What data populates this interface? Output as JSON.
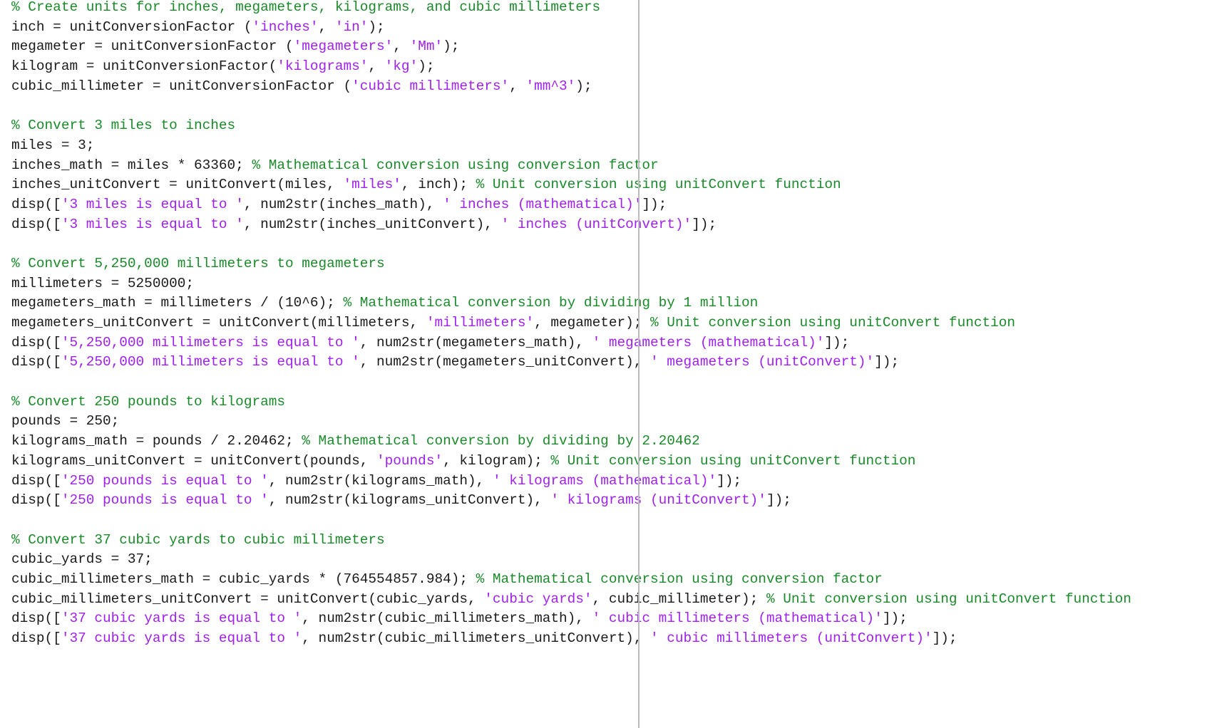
{
  "editor": {
    "language": "matlab",
    "colors": {
      "plain": "#1a1a1a",
      "comment": "#1a8a2a",
      "string": "#a020f0",
      "right_margin_line": "#bdbdbd"
    },
    "lines": [
      [
        [
          "comment",
          "% Create units for inches, megameters, kilograms, and cubic millimeters"
        ]
      ],
      [
        [
          "plain",
          "inch = unitConversionFactor ("
        ],
        [
          "string",
          "'inches'"
        ],
        [
          "plain",
          ", "
        ],
        [
          "string",
          "'in'"
        ],
        [
          "plain",
          ");"
        ]
      ],
      [
        [
          "plain",
          "megameter = unitConversionFactor ("
        ],
        [
          "string",
          "'megameters'"
        ],
        [
          "plain",
          ", "
        ],
        [
          "string",
          "'Mm'"
        ],
        [
          "plain",
          ");"
        ]
      ],
      [
        [
          "plain",
          "kilogram = unitConversionFactor("
        ],
        [
          "string",
          "'kilograms'"
        ],
        [
          "plain",
          ", "
        ],
        [
          "string",
          "'kg'"
        ],
        [
          "plain",
          ");"
        ]
      ],
      [
        [
          "plain",
          "cubic_millimeter = unitConversionFactor ("
        ],
        [
          "string",
          "'cubic millimeters'"
        ],
        [
          "plain",
          ", "
        ],
        [
          "string",
          "'mm^3'"
        ],
        [
          "plain",
          ");"
        ]
      ],
      [],
      [
        [
          "comment",
          "% Convert 3 miles to inches"
        ]
      ],
      [
        [
          "plain",
          "miles = 3;"
        ]
      ],
      [
        [
          "plain",
          "inches_math = miles * 63360; "
        ],
        [
          "comment",
          "% Mathematical conversion using conversion factor"
        ]
      ],
      [
        [
          "plain",
          "inches_unitConvert = unitConvert(miles, "
        ],
        [
          "string",
          "'miles'"
        ],
        [
          "plain",
          ", inch); "
        ],
        [
          "comment",
          "% Unit conversion using unitConvert function"
        ]
      ],
      [
        [
          "plain",
          "disp(["
        ],
        [
          "string",
          "'3 miles is equal to '"
        ],
        [
          "plain",
          ", num2str(inches_math), "
        ],
        [
          "string",
          "' inches (mathematical)'"
        ],
        [
          "plain",
          "]);"
        ]
      ],
      [
        [
          "plain",
          "disp(["
        ],
        [
          "string",
          "'3 miles is equal to '"
        ],
        [
          "plain",
          ", num2str(inches_unitConvert), "
        ],
        [
          "string",
          "' inches (unitConvert)'"
        ],
        [
          "plain",
          "]);"
        ]
      ],
      [],
      [
        [
          "comment",
          "% Convert 5,250,000 millimeters to megameters"
        ]
      ],
      [
        [
          "plain",
          "millimeters = 5250000;"
        ]
      ],
      [
        [
          "plain",
          "megameters_math = millimeters / (10^6); "
        ],
        [
          "comment",
          "% Mathematical conversion by dividing by 1 million"
        ]
      ],
      [
        [
          "plain",
          "megameters_unitConvert = unitConvert(millimeters, "
        ],
        [
          "string",
          "'millimeters'"
        ],
        [
          "plain",
          ", megameter); "
        ],
        [
          "comment",
          "% Unit conversion using unitConvert function"
        ]
      ],
      [
        [
          "plain",
          "disp(["
        ],
        [
          "string",
          "'5,250,000 millimeters is equal to '"
        ],
        [
          "plain",
          ", num2str(megameters_math), "
        ],
        [
          "string",
          "' megameters (mathematical)'"
        ],
        [
          "plain",
          "]);"
        ]
      ],
      [
        [
          "plain",
          "disp(["
        ],
        [
          "string",
          "'5,250,000 millimeters is equal to '"
        ],
        [
          "plain",
          ", num2str(megameters_unitConvert), "
        ],
        [
          "string",
          "' megameters (unitConvert)'"
        ],
        [
          "plain",
          "]);"
        ]
      ],
      [],
      [
        [
          "comment",
          "% Convert 250 pounds to kilograms"
        ]
      ],
      [
        [
          "plain",
          "pounds = 250;"
        ]
      ],
      [
        [
          "plain",
          "kilograms_math = pounds / 2.20462; "
        ],
        [
          "comment",
          "% Mathematical conversion by dividing by 2.20462"
        ]
      ],
      [
        [
          "plain",
          "kilograms_unitConvert = unitConvert(pounds, "
        ],
        [
          "string",
          "'pounds'"
        ],
        [
          "plain",
          ", kilogram); "
        ],
        [
          "comment",
          "% Unit conversion using unitConvert function"
        ]
      ],
      [
        [
          "plain",
          "disp(["
        ],
        [
          "string",
          "'250 pounds is equal to '"
        ],
        [
          "plain",
          ", num2str(kilograms_math), "
        ],
        [
          "string",
          "' kilograms (mathematical)'"
        ],
        [
          "plain",
          "]);"
        ]
      ],
      [
        [
          "plain",
          "disp(["
        ],
        [
          "string",
          "'250 pounds is equal to '"
        ],
        [
          "plain",
          ", num2str(kilograms_unitConvert), "
        ],
        [
          "string",
          "' kilograms (unitConvert)'"
        ],
        [
          "plain",
          "]);"
        ]
      ],
      [],
      [
        [
          "comment",
          "% Convert 37 cubic yards to cubic millimeters"
        ]
      ],
      [
        [
          "plain",
          "cubic_yards = 37;"
        ]
      ],
      [
        [
          "plain",
          "cubic_millimeters_math = cubic_yards * (764554857.984); "
        ],
        [
          "comment",
          "% Mathematical conversion using conversion factor"
        ]
      ],
      [
        [
          "plain",
          "cubic_millimeters_unitConvert = unitConvert(cubic_yards, "
        ],
        [
          "string",
          "'cubic yards'"
        ],
        [
          "plain",
          ", cubic_millimeter); "
        ],
        [
          "comment",
          "% Unit conversion using unitConvert function"
        ]
      ],
      [
        [
          "plain",
          "disp(["
        ],
        [
          "string",
          "'37 cubic yards is equal to '"
        ],
        [
          "plain",
          ", num2str(cubic_millimeters_math), "
        ],
        [
          "string",
          "' cubic millimeters (mathematical)'"
        ],
        [
          "plain",
          "]);"
        ]
      ],
      [
        [
          "plain",
          "disp(["
        ],
        [
          "string",
          "'37 cubic yards is equal to '"
        ],
        [
          "plain",
          ", num2str(cubic_millimeters_unitConvert), "
        ],
        [
          "string",
          "' cubic millimeters (unitConvert)'"
        ],
        [
          "plain",
          "]);"
        ]
      ]
    ]
  }
}
